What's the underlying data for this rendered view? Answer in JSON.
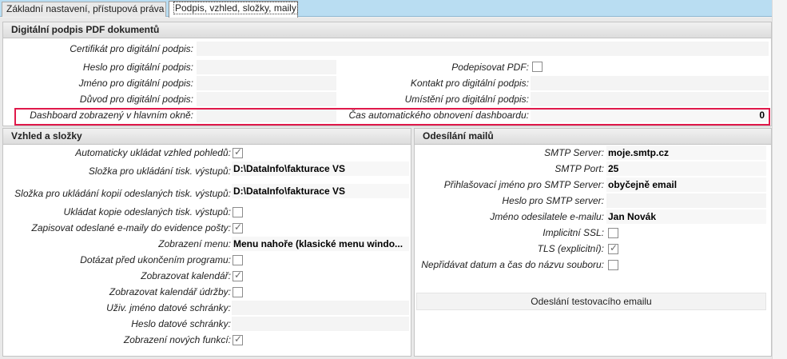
{
  "tabs": [
    {
      "label": "Základní nastavení, přístupová práva",
      "active": false
    },
    {
      "label": "Podpis, vzhled, složky, maily",
      "active": true
    }
  ],
  "signature": {
    "title": "Digitální podpis PDF dokumentů",
    "certificate_label": "Certifikát pro digitální podpis:",
    "password_label": "Heslo pro digitální podpis:",
    "sign_pdf_label": "Podepisovat PDF:",
    "sign_pdf_checked": false,
    "name_label": "Jméno pro digitální podpis:",
    "contact_label": "Kontakt pro digitální podpis:",
    "reason_label": "Důvod pro digitální podpis:",
    "location_label": "Umístění pro digitální podpis:",
    "dashboard_label": "Dashboard zobrazený v hlavním okně:",
    "dashboard_refresh_label": "Čas automatického obnovení dashboardu:",
    "dashboard_refresh_value": "0"
  },
  "appearance": {
    "title": "Vzhled a složky",
    "auto_save_label": "Automaticky ukládat vzhled pohledů:",
    "auto_save_checked": true,
    "print_folder_label": "Složka pro ukládání tisk. výstupů:",
    "print_folder_value": "D:\\DataInfo\\fakturace VS",
    "copy_folder_label": "Složka pro ukládání kopií odeslaných tisk. výstupů:",
    "copy_folder_value": "D:\\DataInfo\\fakturace VS",
    "save_copies_label": "Ukládat kopie odeslaných tisk. výstupů:",
    "save_copies_checked": false,
    "log_emails_label": "Zapisovat odeslané e-maily do evidence pošty:",
    "log_emails_checked": true,
    "menu_label": "Zobrazení menu:",
    "menu_value": "Menu nahoře (klasické menu windo...",
    "ask_exit_label": "Dotázat před ukončením programu:",
    "ask_exit_checked": false,
    "calendar_label": "Zobrazovat kalendář:",
    "calendar_checked": true,
    "maint_calendar_label": "Zobrazovat kalendář údržby:",
    "maint_calendar_checked": false,
    "databox_user_label": "Uživ. jméno datové schránky:",
    "databox_pass_label": "Heslo datové schránky:",
    "new_features_label": "Zobrazení nových funkcí:",
    "new_features_checked": true
  },
  "mail": {
    "title": "Odesílání mailů",
    "smtp_server_label": "SMTP Server:",
    "smtp_server_value": "moje.smtp.cz",
    "smtp_port_label": "SMTP Port:",
    "smtp_port_value": "25",
    "smtp_login_label": "Přihlašovací jméno pro SMTP Server:",
    "smtp_login_value": "obyčejně email",
    "smtp_pass_label": "Heslo pro SMTP server:",
    "sender_label": "Jméno odesilatele e-mailu:",
    "sender_value": "Jan Novák",
    "ssl_label": "Implicitní SSL:",
    "ssl_checked": false,
    "tls_label": "TLS (explicitní):",
    "tls_checked": true,
    "no_date_label": "Nepřidávat datum a čas do názvu souboru:",
    "no_date_checked": false,
    "test_button_label": "Odeslání testovacího emailu"
  }
}
